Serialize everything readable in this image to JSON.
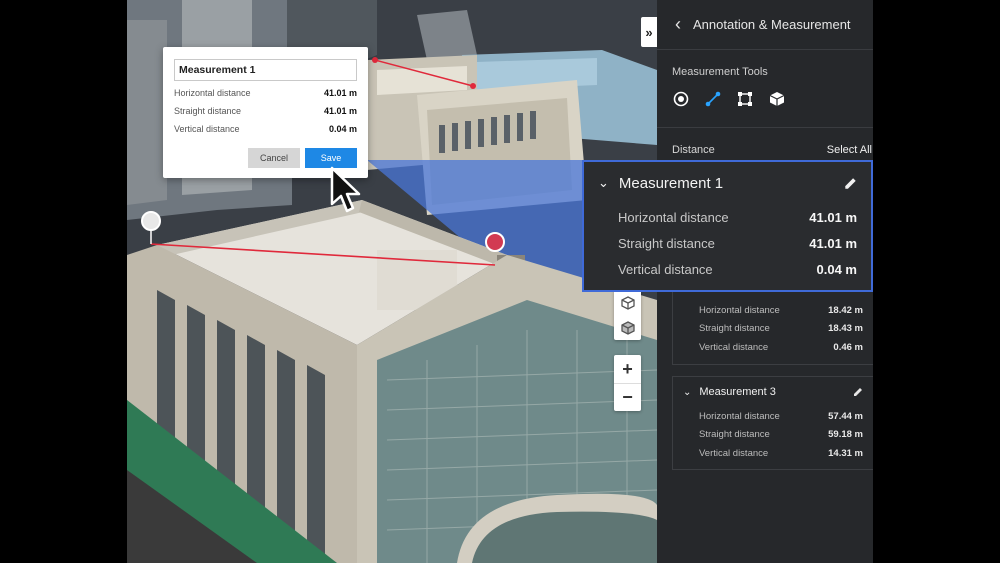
{
  "panel": {
    "title": "Annotation & Measurement",
    "tools_label": "Measurement Tools",
    "tools": [
      "point-tool-icon",
      "distance-tool-icon",
      "area-tool-icon",
      "volume-tool-icon"
    ],
    "distance_label": "Distance",
    "select_all": "Select All",
    "measurements": [
      {
        "name": "",
        "rows": [
          {
            "label": "Horizontal distance",
            "value": "18.42 m"
          },
          {
            "label": "Straight distance",
            "value": "18.43 m"
          },
          {
            "label": "Vertical distance",
            "value": "0.46 m"
          }
        ]
      },
      {
        "name": "Measurement 3",
        "rows": [
          {
            "label": "Horizontal distance",
            "value": "57.44 m"
          },
          {
            "label": "Straight distance",
            "value": "59.18 m"
          },
          {
            "label": "Vertical distance",
            "value": "14.31 m"
          }
        ]
      }
    ]
  },
  "popup": {
    "name_value": "Measurement 1",
    "rows": [
      {
        "label": "Horizontal distance",
        "value": "41.01 m"
      },
      {
        "label": "Straight distance",
        "value": "41.01 m"
      },
      {
        "label": "Vertical distance",
        "value": "0.04 m"
      }
    ],
    "cancel": "Cancel",
    "save": "Save"
  },
  "callout": {
    "name": "Measurement 1",
    "rows": [
      {
        "label": "Horizontal distance",
        "value": "41.01 m"
      },
      {
        "label": "Straight distance",
        "value": "41.01 m"
      },
      {
        "label": "Vertical distance",
        "value": "0.04 m"
      }
    ]
  },
  "controls": {
    "collapse": "»",
    "zoom_in": "+",
    "zoom_out": "−"
  },
  "colors": {
    "accent": "#1e88e5",
    "highlight_border": "#3f6ad8",
    "measure_line": "#e0293b",
    "panel_bg": "#26282b"
  }
}
